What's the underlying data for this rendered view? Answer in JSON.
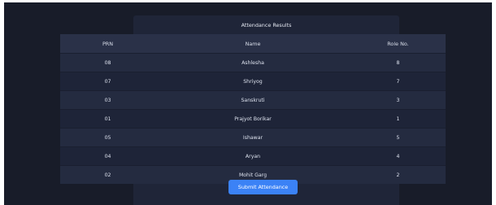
{
  "page": {
    "title": "Attendance Results"
  },
  "table": {
    "headers": {
      "prn": "PRN",
      "name": "Name",
      "role": "Role No."
    },
    "rows": [
      {
        "prn": "08",
        "name": "Ashlesha",
        "role": "8"
      },
      {
        "prn": "07",
        "name": "Shriyog",
        "role": "7"
      },
      {
        "prn": "03",
        "name": "Sanskruti",
        "role": "3"
      },
      {
        "prn": "01",
        "name": "Prajyot Borikar",
        "role": "1"
      },
      {
        "prn": "05",
        "name": "Ishawar",
        "role": "5"
      },
      {
        "prn": "04",
        "name": "Aryan",
        "role": "4"
      },
      {
        "prn": "02",
        "name": "Mohit Garg",
        "role": "2"
      }
    ]
  },
  "actions": {
    "submit_label": "Submit Attendance"
  },
  "colors": {
    "background": "#181c29",
    "panel": "#1f2538",
    "header_row": "#2a3148",
    "accent": "#3b82f6"
  }
}
